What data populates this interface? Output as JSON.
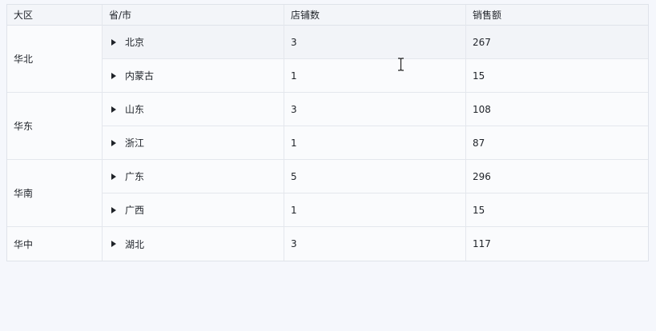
{
  "table": {
    "headers": [
      "大区",
      "省/市",
      "店铺数",
      "销售额"
    ],
    "regions": [
      {
        "name": "华北",
        "rows": [
          {
            "province": "北京",
            "stores": "3",
            "sales": "267"
          },
          {
            "province": "内蒙古",
            "stores": "1",
            "sales": "15"
          }
        ]
      },
      {
        "name": "华东",
        "rows": [
          {
            "province": "山东",
            "stores": "3",
            "sales": "108"
          },
          {
            "province": "浙江",
            "stores": "1",
            "sales": "87"
          }
        ]
      },
      {
        "name": "华南",
        "rows": [
          {
            "province": "广东",
            "stores": "5",
            "sales": "296"
          },
          {
            "province": "广西",
            "stores": "1",
            "sales": "15"
          }
        ]
      },
      {
        "name": "华中",
        "rows": [
          {
            "province": "湖北",
            "stores": "3",
            "sales": "117"
          }
        ]
      }
    ]
  },
  "icons": {
    "expand": "caret-right-icon",
    "cursor": "text-cursor-icon"
  }
}
